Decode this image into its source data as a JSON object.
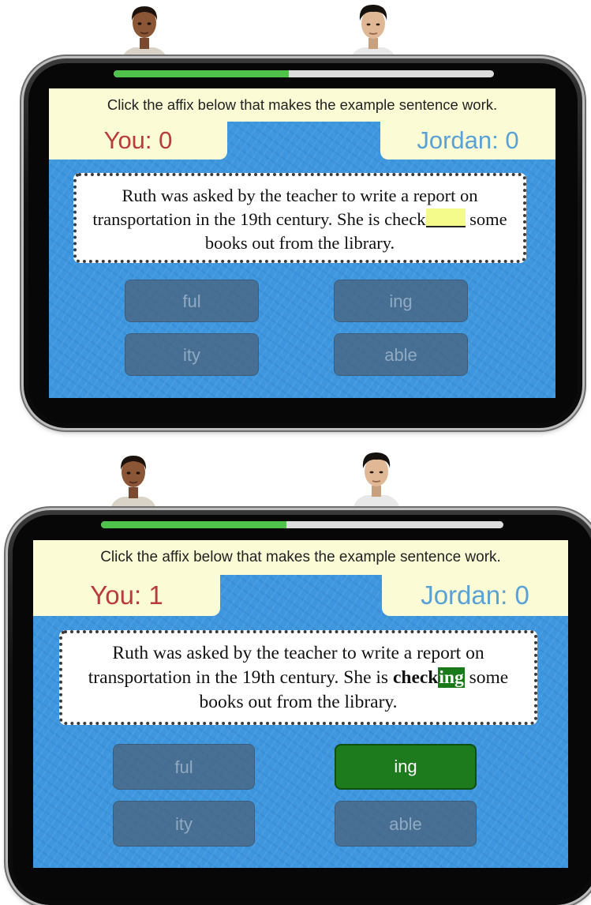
{
  "panels": [
    {
      "instruction": "Click the affix below that makes the example sentence work.",
      "score_you": "You: 0",
      "score_opponent": "Jordan: 0",
      "progress_fraction": 0.46,
      "sentence_before": "Ruth was asked by the teacher to write a report on transportation in the 19th century. She is check",
      "sentence_after": " some books out from the library.",
      "options": [
        "ful",
        "ing",
        "ity",
        "able"
      ]
    },
    {
      "instruction": "Click the affix below that makes the example sentence work.",
      "score_you": "You: 1",
      "score_opponent": "Jordan: 0",
      "progress_fraction": 0.46,
      "sentence_before": "Ruth was asked by the teacher to write a report on transportation in the 19th century. She is ",
      "sentence_root": "check",
      "sentence_answer": "ing",
      "sentence_after": " some books out from the library.",
      "options": [
        "ful",
        "ing",
        "ity",
        "able"
      ],
      "selected_option": "ing"
    }
  ],
  "colors": {
    "screen_blue": "#3d96de",
    "instruction_bg": "#fbfbd6",
    "score_you": "#b93c3c",
    "score_opponent": "#5aa1d6",
    "progress_fill": "#4fc24b",
    "correct_green": "#1d7a1d",
    "blank_yellow": "#f4fb8a"
  }
}
